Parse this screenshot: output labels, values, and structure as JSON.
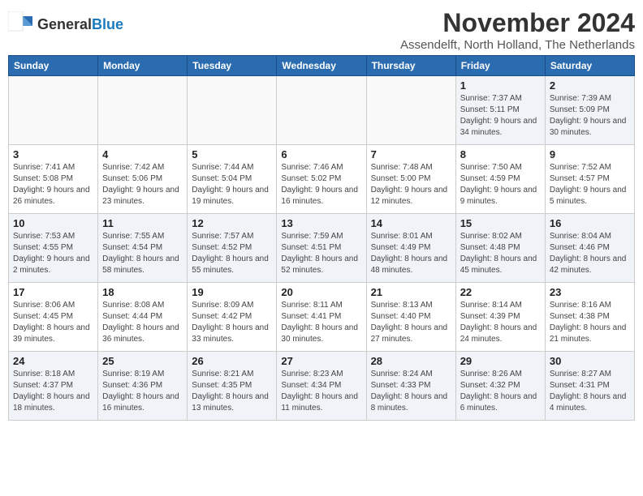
{
  "header": {
    "logo_general": "General",
    "logo_blue": "Blue",
    "title": "November 2024",
    "location": "Assendelft, North Holland, The Netherlands"
  },
  "weekdays": [
    "Sunday",
    "Monday",
    "Tuesday",
    "Wednesday",
    "Thursday",
    "Friday",
    "Saturday"
  ],
  "weeks": [
    [
      {
        "day": "",
        "info": ""
      },
      {
        "day": "",
        "info": ""
      },
      {
        "day": "",
        "info": ""
      },
      {
        "day": "",
        "info": ""
      },
      {
        "day": "",
        "info": ""
      },
      {
        "day": "1",
        "info": "Sunrise: 7:37 AM\nSunset: 5:11 PM\nDaylight: 9 hours and 34 minutes."
      },
      {
        "day": "2",
        "info": "Sunrise: 7:39 AM\nSunset: 5:09 PM\nDaylight: 9 hours and 30 minutes."
      }
    ],
    [
      {
        "day": "3",
        "info": "Sunrise: 7:41 AM\nSunset: 5:08 PM\nDaylight: 9 hours and 26 minutes."
      },
      {
        "day": "4",
        "info": "Sunrise: 7:42 AM\nSunset: 5:06 PM\nDaylight: 9 hours and 23 minutes."
      },
      {
        "day": "5",
        "info": "Sunrise: 7:44 AM\nSunset: 5:04 PM\nDaylight: 9 hours and 19 minutes."
      },
      {
        "day": "6",
        "info": "Sunrise: 7:46 AM\nSunset: 5:02 PM\nDaylight: 9 hours and 16 minutes."
      },
      {
        "day": "7",
        "info": "Sunrise: 7:48 AM\nSunset: 5:00 PM\nDaylight: 9 hours and 12 minutes."
      },
      {
        "day": "8",
        "info": "Sunrise: 7:50 AM\nSunset: 4:59 PM\nDaylight: 9 hours and 9 minutes."
      },
      {
        "day": "9",
        "info": "Sunrise: 7:52 AM\nSunset: 4:57 PM\nDaylight: 9 hours and 5 minutes."
      }
    ],
    [
      {
        "day": "10",
        "info": "Sunrise: 7:53 AM\nSunset: 4:55 PM\nDaylight: 9 hours and 2 minutes."
      },
      {
        "day": "11",
        "info": "Sunrise: 7:55 AM\nSunset: 4:54 PM\nDaylight: 8 hours and 58 minutes."
      },
      {
        "day": "12",
        "info": "Sunrise: 7:57 AM\nSunset: 4:52 PM\nDaylight: 8 hours and 55 minutes."
      },
      {
        "day": "13",
        "info": "Sunrise: 7:59 AM\nSunset: 4:51 PM\nDaylight: 8 hours and 52 minutes."
      },
      {
        "day": "14",
        "info": "Sunrise: 8:01 AM\nSunset: 4:49 PM\nDaylight: 8 hours and 48 minutes."
      },
      {
        "day": "15",
        "info": "Sunrise: 8:02 AM\nSunset: 4:48 PM\nDaylight: 8 hours and 45 minutes."
      },
      {
        "day": "16",
        "info": "Sunrise: 8:04 AM\nSunset: 4:46 PM\nDaylight: 8 hours and 42 minutes."
      }
    ],
    [
      {
        "day": "17",
        "info": "Sunrise: 8:06 AM\nSunset: 4:45 PM\nDaylight: 8 hours and 39 minutes."
      },
      {
        "day": "18",
        "info": "Sunrise: 8:08 AM\nSunset: 4:44 PM\nDaylight: 8 hours and 36 minutes."
      },
      {
        "day": "19",
        "info": "Sunrise: 8:09 AM\nSunset: 4:42 PM\nDaylight: 8 hours and 33 minutes."
      },
      {
        "day": "20",
        "info": "Sunrise: 8:11 AM\nSunset: 4:41 PM\nDaylight: 8 hours and 30 minutes."
      },
      {
        "day": "21",
        "info": "Sunrise: 8:13 AM\nSunset: 4:40 PM\nDaylight: 8 hours and 27 minutes."
      },
      {
        "day": "22",
        "info": "Sunrise: 8:14 AM\nSunset: 4:39 PM\nDaylight: 8 hours and 24 minutes."
      },
      {
        "day": "23",
        "info": "Sunrise: 8:16 AM\nSunset: 4:38 PM\nDaylight: 8 hours and 21 minutes."
      }
    ],
    [
      {
        "day": "24",
        "info": "Sunrise: 8:18 AM\nSunset: 4:37 PM\nDaylight: 8 hours and 18 minutes."
      },
      {
        "day": "25",
        "info": "Sunrise: 8:19 AM\nSunset: 4:36 PM\nDaylight: 8 hours and 16 minutes."
      },
      {
        "day": "26",
        "info": "Sunrise: 8:21 AM\nSunset: 4:35 PM\nDaylight: 8 hours and 13 minutes."
      },
      {
        "day": "27",
        "info": "Sunrise: 8:23 AM\nSunset: 4:34 PM\nDaylight: 8 hours and 11 minutes."
      },
      {
        "day": "28",
        "info": "Sunrise: 8:24 AM\nSunset: 4:33 PM\nDaylight: 8 hours and 8 minutes."
      },
      {
        "day": "29",
        "info": "Sunrise: 8:26 AM\nSunset: 4:32 PM\nDaylight: 8 hours and 6 minutes."
      },
      {
        "day": "30",
        "info": "Sunrise: 8:27 AM\nSunset: 4:31 PM\nDaylight: 8 hours and 4 minutes."
      }
    ]
  ]
}
